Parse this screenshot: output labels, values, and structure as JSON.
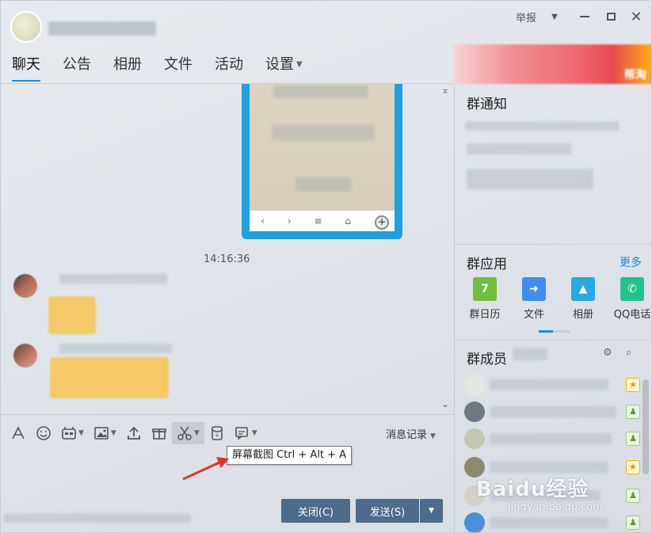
{
  "window": {
    "report_label": "举报",
    "report_dropdown": "▼",
    "close_glyph": "✕"
  },
  "tabs": [
    {
      "label": "聊天"
    },
    {
      "label": "公告"
    },
    {
      "label": "相册"
    },
    {
      "label": "文件"
    },
    {
      "label": "活动"
    },
    {
      "label": "设置"
    }
  ],
  "ad": {
    "text": "帮淘"
  },
  "chat": {
    "timestamp": "14:16:36",
    "phone_nav": [
      "‹",
      "›",
      "≡",
      "⌂"
    ]
  },
  "toolbar": {
    "history_label": "消息记录",
    "screenshot_tooltip": "屏幕截图 Ctrl + Alt + A"
  },
  "buttons": {
    "close_label": "关闭(C)",
    "send_label": "发送(S)",
    "send_dropdown": "▼"
  },
  "right_panel": {
    "notice_title": "群通知",
    "apps_title": "群应用",
    "more_label": "更多",
    "apps": [
      {
        "label": "群日历",
        "icon": "calendar-icon",
        "color": "#6fbf3a",
        "glyph": "7"
      },
      {
        "label": "文件",
        "icon": "folder-icon",
        "color": "#3d8ef0",
        "glyph": "➜"
      },
      {
        "label": "相册",
        "icon": "photo-icon",
        "color": "#28a9e0",
        "glyph": "▲"
      },
      {
        "label": "QQ电话",
        "icon": "phone-icon",
        "color": "#22c38a",
        "glyph": "✆"
      }
    ],
    "members_title": "群成员"
  },
  "watermark": {
    "text": "Baidu经验",
    "url": "jingyan.baidu.com"
  },
  "colors": {
    "accent": "#1e88e5",
    "button": "#4d6b8a",
    "phone_frame": "#1ea2df"
  }
}
